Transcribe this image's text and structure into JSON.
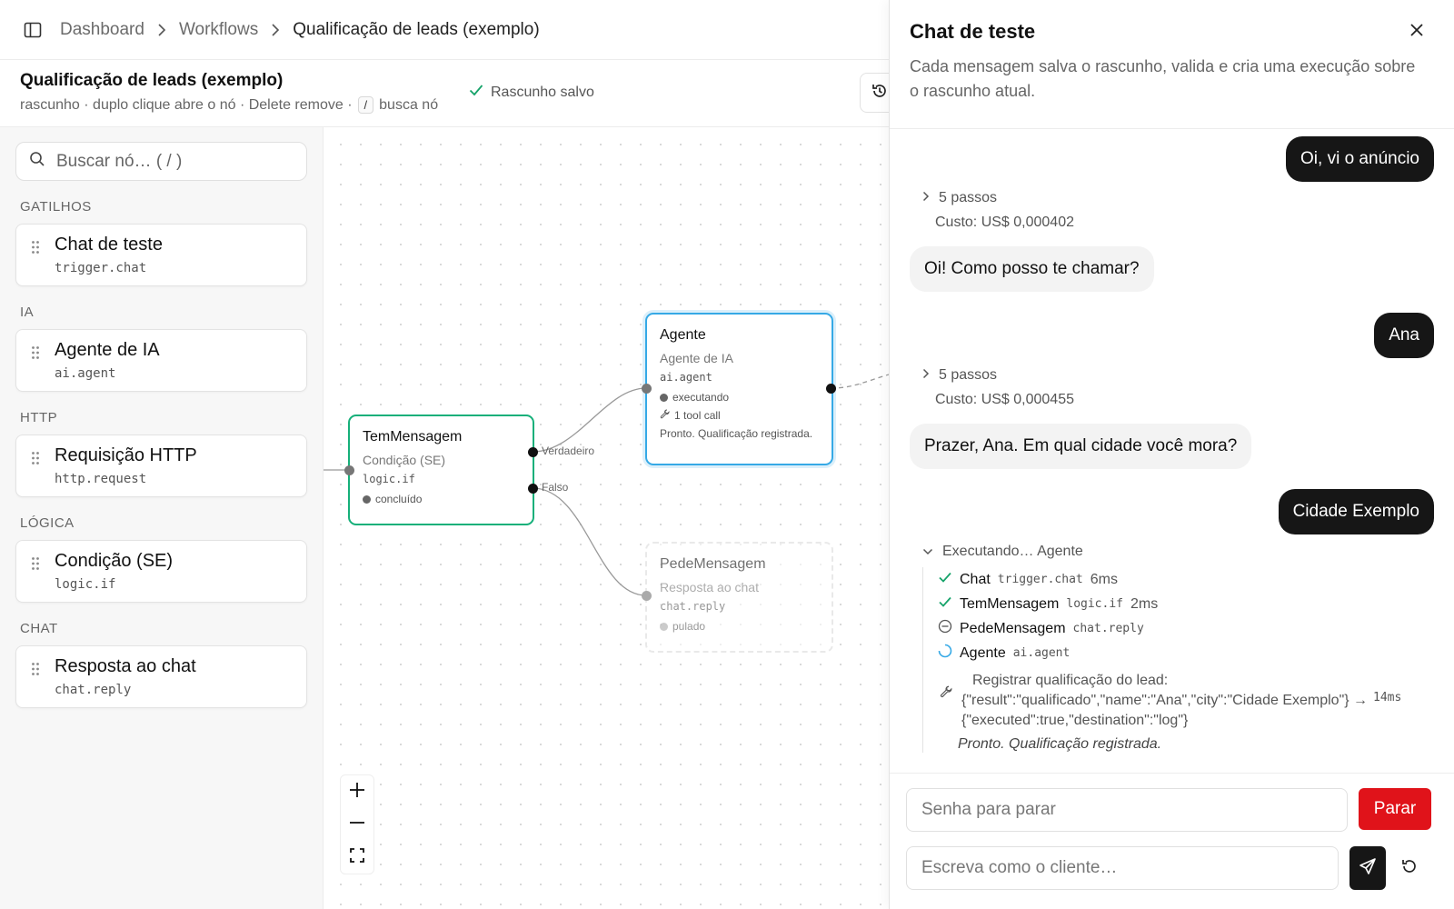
{
  "breadcrumb": {
    "items": [
      "Dashboard",
      "Workflows"
    ],
    "current": "Qualificação de leads (exemplo)"
  },
  "workflow": {
    "title": "Qualificação de leads (exemplo)",
    "hint_prefix": "rascunho · duplo clique abre o nó · Delete remove ·",
    "hint_key": "/",
    "hint_suffix": "busca nó",
    "saved_status": "Rascunho salvo"
  },
  "palette": {
    "search_placeholder": "Buscar nó… ( / )",
    "sections": [
      {
        "label": "GATILHOS",
        "items": [
          {
            "name": "Chat de teste",
            "type": "trigger.chat"
          }
        ]
      },
      {
        "label": "IA",
        "items": [
          {
            "name": "Agente de IA",
            "type": "ai.agent"
          }
        ]
      },
      {
        "label": "HTTP",
        "items": [
          {
            "name": "Requisição HTTP",
            "type": "http.request"
          }
        ]
      },
      {
        "label": "LÓGICA",
        "items": [
          {
            "name": "Condição (SE)",
            "type": "logic.if"
          }
        ]
      },
      {
        "label": "CHAT",
        "items": [
          {
            "name": "Resposta ao chat",
            "type": "chat.reply"
          }
        ]
      }
    ]
  },
  "canvas": {
    "nodes": {
      "tem_mensagem": {
        "title": "TemMensagem",
        "subtitle": "Condição (SE)",
        "type": "logic.if",
        "status": "concluído",
        "border_color": "#16b07a"
      },
      "agente": {
        "title": "Agente",
        "subtitle": "Agente de IA",
        "type": "ai.agent",
        "status": "executando",
        "tool_calls": "1 tool call",
        "result": "Pronto. Qualificação registrada.",
        "border_color": "#36a9e6"
      },
      "pede_mensagem": {
        "title": "PedeMensagem",
        "subtitle": "Resposta ao chat",
        "type": "chat.reply",
        "status": "pulado"
      }
    },
    "edge_labels": {
      "true": "Verdadeiro",
      "false": "Falso"
    }
  },
  "chat": {
    "title": "Chat de teste",
    "description": "Cada mensagem salva o rascunho, valida e cria uma execução sobre o rascunho atual.",
    "messages": {
      "user_1": "Oi, vi o anúncio",
      "steps_1": "5 passos",
      "cost_1": "Custo: US$ 0,000402",
      "bot_1": "Oi! Como posso te chamar?",
      "user_2": "Ana",
      "steps_2": "5 passos",
      "cost_2": "Custo: US$ 0,000455",
      "bot_2": "Prazer, Ana. Em qual cidade você mora?",
      "user_3": "Cidade Exemplo"
    },
    "execution": {
      "header": "Executando… Agente",
      "steps": [
        {
          "name": "Chat",
          "type": "trigger.chat",
          "duration": "6ms",
          "state": "done"
        },
        {
          "name": "TemMensagem",
          "type": "logic.if",
          "duration": "2ms",
          "state": "done"
        },
        {
          "name": "PedeMensagem",
          "type": "chat.reply",
          "duration": "",
          "state": "skipped"
        },
        {
          "name": "Agente",
          "type": "ai.agent",
          "duration": "",
          "state": "running"
        }
      ],
      "tool_label": "Registrar qualificação do lead:",
      "tool_input": "{\"result\":\"qualificado\",\"name\":\"Ana\",\"city\":\"Cidade Exemplo\"} →",
      "tool_output": "{\"executed\":true,\"destination\":\"log\"}",
      "tool_duration": "14ms",
      "final": "Pronto. Qualificação registrada."
    },
    "password_placeholder": "Senha para parar",
    "stop_label": "Parar",
    "message_placeholder": "Escreva como o cliente…"
  },
  "colors": {
    "stop": "#e0131a",
    "check": "#16a36a",
    "running": "#36a9e6"
  }
}
